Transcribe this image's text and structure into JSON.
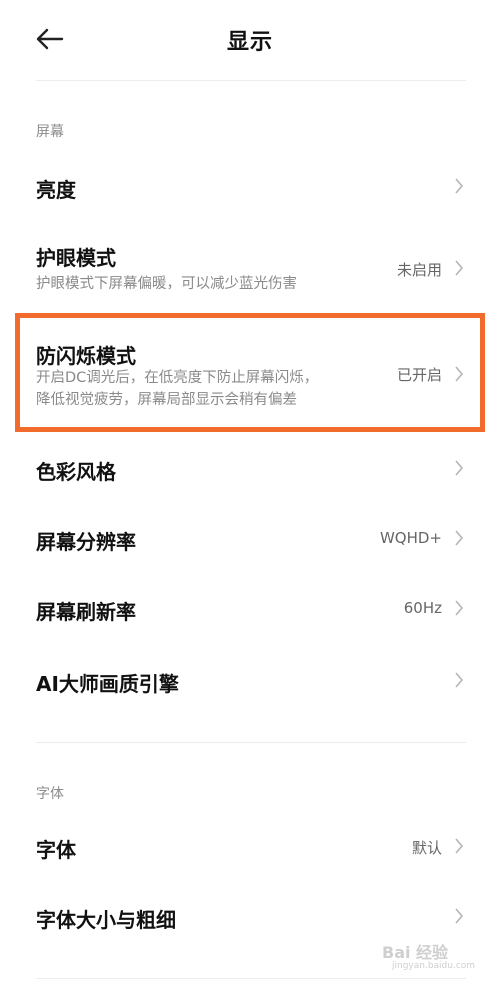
{
  "header": {
    "title": "显示"
  },
  "sections": {
    "screen": "屏幕",
    "font": "字体"
  },
  "rows": {
    "brightness": {
      "label": "亮度"
    },
    "eye_care": {
      "label": "护眼模式",
      "desc": "护眼模式下屏幕偏暖，可以减少蓝光伤害",
      "value": "未启用"
    },
    "anti_flicker": {
      "label": "防闪烁模式",
      "desc_line1": "开启DC调光后，在低亮度下防止屏幕闪烁，",
      "desc_line2": "降低视觉疲劳，屏幕局部显示会稍有偏差",
      "value": "已开启"
    },
    "color_style": {
      "label": "色彩风格"
    },
    "resolution": {
      "label": "屏幕分辨率",
      "value": "WQHD+"
    },
    "refresh_rate": {
      "label": "屏幕刷新率",
      "value": "60Hz"
    },
    "ai_engine": {
      "label": "AI大师画质引擎"
    },
    "font": {
      "label": "字体",
      "value": "默认"
    },
    "font_size": {
      "label": "字体大小与粗细"
    }
  },
  "watermark": {
    "text": "Bai 经验",
    "url": "jingyan.baidu.com"
  },
  "colors": {
    "highlight": "#f06b2c",
    "label": "#111111",
    "secondary": "#8a8a8a"
  },
  "icons": [
    "back-arrow-icon",
    "chevron-right-icon"
  ]
}
